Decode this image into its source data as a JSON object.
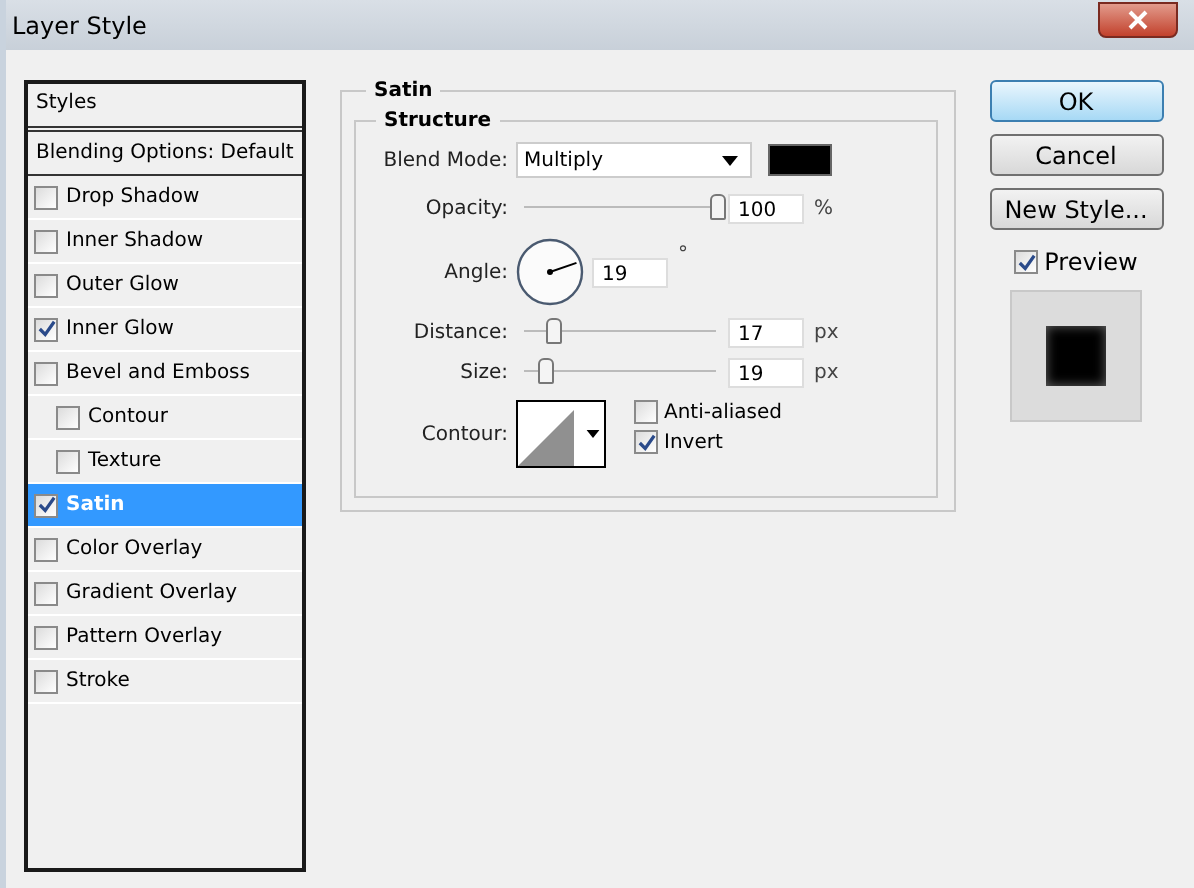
{
  "window": {
    "title": "Layer Style"
  },
  "styles_panel": {
    "header": "Styles",
    "blending": "Blending Options: Default",
    "items": [
      {
        "label": "Drop Shadow",
        "checked": false,
        "selected": false
      },
      {
        "label": "Inner Shadow",
        "checked": false,
        "selected": false
      },
      {
        "label": "Outer Glow",
        "checked": false,
        "selected": false
      },
      {
        "label": "Inner Glow",
        "checked": true,
        "selected": false
      },
      {
        "label": "Bevel and Emboss",
        "checked": false,
        "selected": false,
        "children": [
          {
            "label": "Contour",
            "checked": false,
            "selected": false
          },
          {
            "label": "Texture",
            "checked": false,
            "selected": false
          }
        ]
      },
      {
        "label": "Satin",
        "checked": true,
        "selected": true
      },
      {
        "label": "Color Overlay",
        "checked": false,
        "selected": false
      },
      {
        "label": "Gradient Overlay",
        "checked": false,
        "selected": false
      },
      {
        "label": "Pattern Overlay",
        "checked": false,
        "selected": false
      },
      {
        "label": "Stroke",
        "checked": false,
        "selected": false
      }
    ]
  },
  "satin": {
    "title": "Satin",
    "structure_title": "Structure",
    "blend_mode": {
      "label": "Blend Mode:",
      "value": "Multiply",
      "color": "#000000"
    },
    "opacity": {
      "label": "Opacity:",
      "level": 1.0,
      "value": "100",
      "unit": "%"
    },
    "angle": {
      "label": "Angle:",
      "value": "19",
      "unit": "°"
    },
    "distance": {
      "label": "Distance:",
      "level": 0.15,
      "value": "17",
      "unit": "px"
    },
    "size": {
      "label": "Size:",
      "level": 0.1,
      "value": "19",
      "unit": "px"
    },
    "contour": {
      "label": "Contour:"
    },
    "anti_aliased": {
      "label": "Anti-aliased",
      "checked": false
    },
    "invert": {
      "label": "Invert",
      "checked": true
    }
  },
  "buttons": [
    {
      "label": "OK",
      "default": true
    },
    {
      "label": "Cancel",
      "default": false
    },
    {
      "label": "New Style...",
      "default": false
    }
  ],
  "preview": {
    "label": "Preview",
    "checked": true
  }
}
